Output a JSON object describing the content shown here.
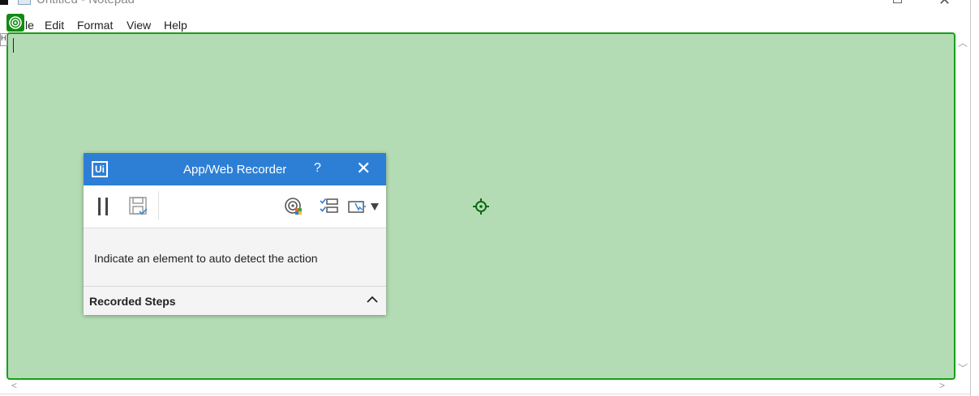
{
  "window": {
    "title": "Untitled - Notepad",
    "icons": {
      "app": "notepad-icon",
      "maximize": "maximize-icon",
      "close": "close-icon"
    }
  },
  "menubar": {
    "items": [
      "File",
      "Edit",
      "Format",
      "View",
      "Help"
    ],
    "visible_file_text": "le"
  },
  "editor": {
    "text": ""
  },
  "highlight": {
    "color": "#16a016",
    "fill": "#b4dcb4",
    "badge_icon": "target-icon",
    "cursor_icon": "crosshair-icon"
  },
  "recorder": {
    "logo": "Ui",
    "title": "App/Web Recorder",
    "help": "?",
    "close_icon": "close-icon",
    "header_color": "#2d7fd6",
    "toolbar": {
      "pause_icon": "pause-icon",
      "save_icon": "save-icon",
      "detect_icon": "auto-detect-icon",
      "steps_icon": "steps-list-icon",
      "screen_icon": "screen-selection-icon"
    },
    "message": "Indicate an element to auto detect the action",
    "steps_label": "Recorded Steps",
    "steps_toggle_icon": "chevron-up-icon"
  }
}
